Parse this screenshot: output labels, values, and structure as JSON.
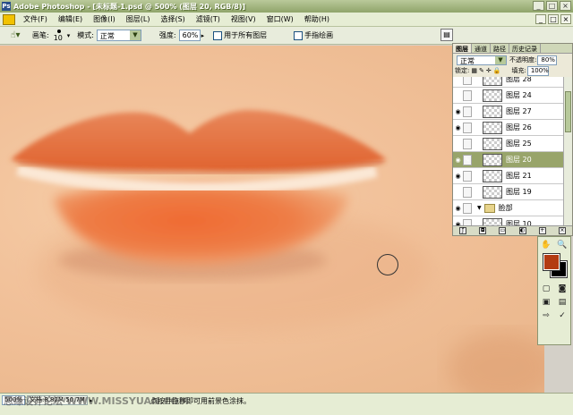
{
  "window": {
    "title": "Adobe Photoshop - [未标题-1.psd @ 500% (图层 20, RGB/8)]",
    "app_icon": "Ps",
    "controls": [
      "_",
      "□",
      "×"
    ]
  },
  "menu": {
    "items": [
      "文件(F)",
      "编辑(E)",
      "图像(I)",
      "图层(L)",
      "选择(S)",
      "滤镜(T)",
      "视图(V)",
      "窗口(W)",
      "帮助(H)"
    ],
    "doc_controls": [
      "_",
      "□",
      "×"
    ]
  },
  "options": {
    "tool_icon": "brush-icon",
    "brush_label": "画笔:",
    "brush_size": "10",
    "mode_label": "模式:",
    "mode_value": "正常",
    "opacity_label": "强度:",
    "opacity_value": "60%",
    "sample_all_label": "用于所有图层",
    "finger_paint_label": "手指绘画"
  },
  "layers_palette": {
    "tabs": [
      "图层",
      "通道",
      "路径",
      "历史记录"
    ],
    "blend_mode": "正常",
    "opacity_label": "不透明度:",
    "opacity_value": "80%",
    "lock_label": "锁定:",
    "fill_label": "填充:",
    "fill_value": "100%",
    "layers": [
      {
        "name": "图层 28",
        "visible": false,
        "selected": false,
        "folder": false
      },
      {
        "name": "图层 24",
        "visible": false,
        "selected": false,
        "folder": false
      },
      {
        "name": "图层 27",
        "visible": true,
        "selected": false,
        "folder": false
      },
      {
        "name": "图层 26",
        "visible": true,
        "selected": false,
        "folder": false
      },
      {
        "name": "图层 25",
        "visible": false,
        "selected": false,
        "folder": false
      },
      {
        "name": "图层 20",
        "visible": true,
        "selected": true,
        "folder": false
      },
      {
        "name": "图层 21",
        "visible": true,
        "selected": false,
        "folder": false
      },
      {
        "name": "图层 19",
        "visible": false,
        "selected": false,
        "folder": false
      },
      {
        "name": "脸部",
        "visible": true,
        "selected": false,
        "folder": true
      },
      {
        "name": "图层 10",
        "visible": true,
        "selected": false,
        "folder": false
      }
    ]
  },
  "colors": {
    "foreground": "#b33a12",
    "background": "#000000"
  },
  "status": {
    "zoom": "500%",
    "doc_info": "文档:8.82M/50.7M",
    "message": "点按并拖移即可用前景色涂抹。",
    "watermark": "思缘设计论坛 WWW.MISSYUAN.COM"
  }
}
